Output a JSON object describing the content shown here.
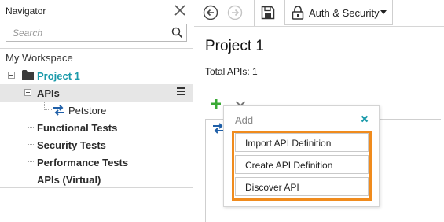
{
  "navigator": {
    "title": "Navigator",
    "search_placeholder": "Search",
    "workspace_label": "My Workspace",
    "tree": {
      "project": "Project 1",
      "apis": "APIs",
      "petstore": "Petstore",
      "functional_tests": "Functional Tests",
      "security_tests": "Security Tests",
      "performance_tests": "Performance Tests",
      "apis_virtual": "APIs (Virtual)"
    }
  },
  "toolbar": {
    "auth_security_label": "Auth & Security",
    "icons": [
      "back-arrow-icon",
      "forward-arrow-icon",
      "save-icon",
      "lock-icon"
    ]
  },
  "main": {
    "page_title": "Project 1",
    "total_apis": "Total APIs: 1"
  },
  "add_popup": {
    "title": "Add",
    "items": [
      "Import API Definition",
      "Create API Definition",
      "Discover API"
    ]
  },
  "colors": {
    "accent_teal": "#1b9aaa",
    "highlight_orange": "#f08b1d",
    "add_green": "#3aa935",
    "icon_blue": "#1f5fa8",
    "selected_row": "#e6e6e6"
  }
}
